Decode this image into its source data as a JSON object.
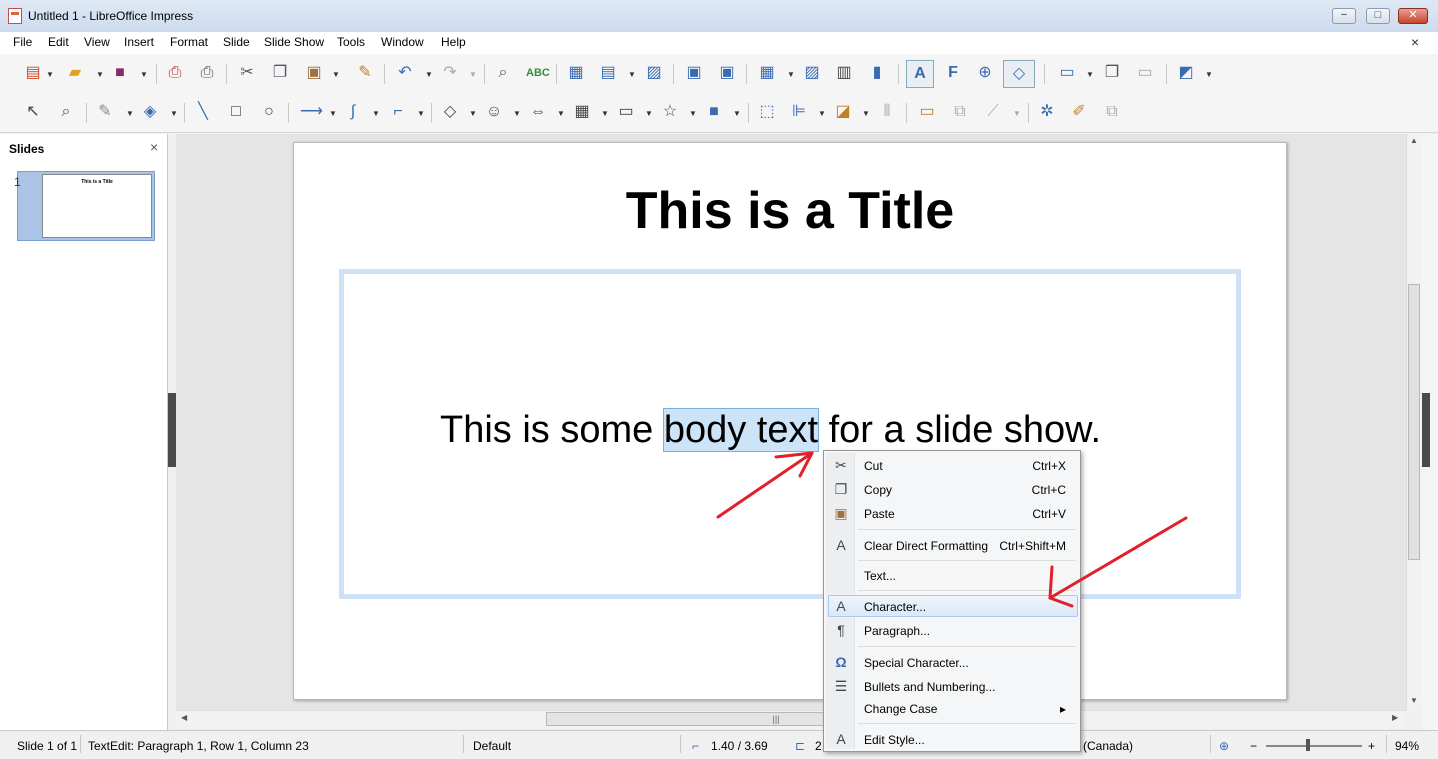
{
  "window": {
    "title": "Untitled 1 - LibreOffice Impress",
    "minimize": "−",
    "maximize": "□",
    "close": "✕"
  },
  "menu": [
    "File",
    "Edit",
    "View",
    "Insert",
    "Format",
    "Slide",
    "Slide Show",
    "Tools",
    "Window",
    "Help"
  ],
  "doc_close": "×",
  "slides_pane": {
    "title": "Slides",
    "close": "×",
    "slide_number": "1",
    "thumb_title": "This is a Title"
  },
  "slide": {
    "title": "This is a Title",
    "body_before": "This is some ",
    "body_selected": "body text",
    "body_after": " for a slide show."
  },
  "scroll": {
    "grip": "|||"
  },
  "status": {
    "slide": "Slide 1 of 1",
    "edit": "TextEdit: Paragraph 1, Row 1, Column 23",
    "master": "Default",
    "position": "1.40 / 3.69",
    "size_partial": "2",
    "language": "(Canada)",
    "zoom": "94%",
    "zoom_minus": "−",
    "zoom_plus": "+"
  },
  "context_menu": {
    "items": [
      {
        "label": "Cut",
        "shortcut": "Ctrl+X",
        "icon": "scissors-icon"
      },
      {
        "label": "Copy",
        "shortcut": "Ctrl+C",
        "icon": "copy-icon"
      },
      {
        "label": "Paste",
        "shortcut": "Ctrl+V",
        "icon": "paste-icon"
      },
      {
        "label": "Clear Direct Formatting",
        "shortcut": "Ctrl+Shift+M",
        "icon": "clear-format-icon"
      },
      {
        "label": "Text...",
        "shortcut": "",
        "icon": ""
      },
      {
        "label": "Character...",
        "shortcut": "",
        "icon": "character-icon"
      },
      {
        "label": "Paragraph...",
        "shortcut": "",
        "icon": "paragraph-icon"
      },
      {
        "label": "Special Character...",
        "shortcut": "",
        "icon": "omega-icon"
      },
      {
        "label": "Bullets and Numbering...",
        "shortcut": "",
        "icon": "bullets-icon"
      },
      {
        "label": "Change Case",
        "shortcut": "",
        "icon": ""
      },
      {
        "label": "Edit Style...",
        "shortcut": "",
        "icon": "edit-style-icon"
      }
    ],
    "submenu_arrow": "▸"
  },
  "colors": {
    "annotation_arrow": "#e0202a",
    "selection": "#cde3f7",
    "hover": "#dce8f6"
  }
}
